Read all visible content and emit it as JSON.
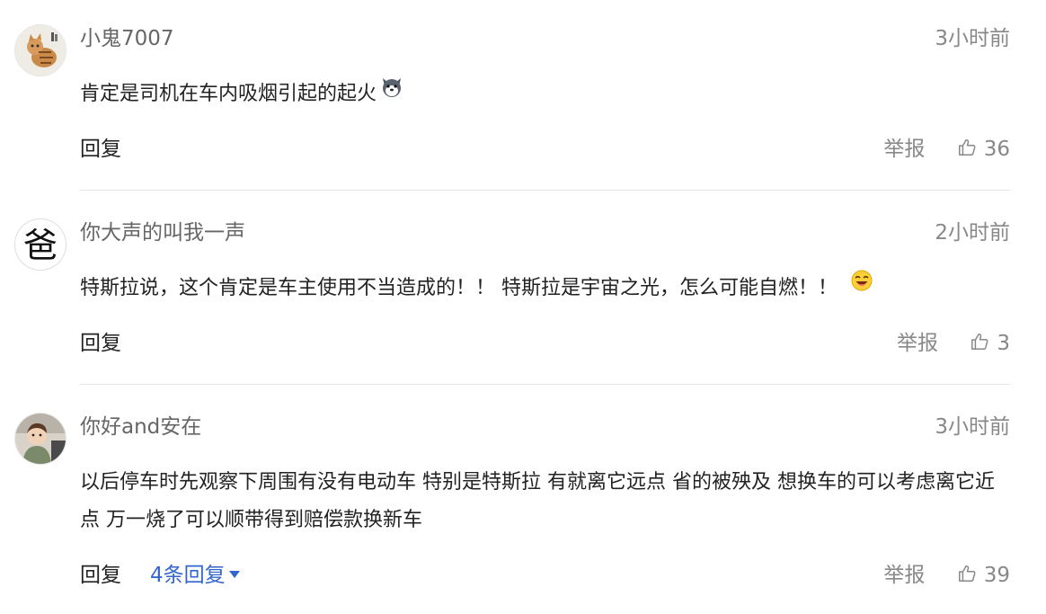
{
  "colors": {
    "text": "#222222",
    "meta": "#888888",
    "username": "#666666",
    "link": "#3366cc",
    "divider": "#e5e5e5"
  },
  "comments": [
    {
      "username": "小鬼7007",
      "time": "3小时前",
      "text": "肯定是司机在车内吸烟引起的起火",
      "emoji_icon": "dog-face-emoji-icon",
      "reply_label": "回复",
      "report_label": "举报",
      "likes": "36"
    },
    {
      "username": "你大声的叫我一声",
      "avatar_text": "爸",
      "time": "2小时前",
      "text": "特斯拉说，这个肯定是车主使用不当造成的！！ 特斯拉是宇宙之光，怎么可能自燃！！",
      "emoji_icon": "laughing-face-emoji-icon",
      "reply_label": "回复",
      "report_label": "举报",
      "likes": "3"
    },
    {
      "username": "你好and安在",
      "time": "3小时前",
      "text": "以后停车时先观察下周围有没有电动车 特别是特斯拉 有就离它远点 省的被殃及 想换车的可以考虑离它近点 万一烧了可以顺带得到赔偿款换新车",
      "reply_label": "回复",
      "more_replies": "4条回复",
      "report_label": "举报",
      "likes": "39"
    }
  ]
}
